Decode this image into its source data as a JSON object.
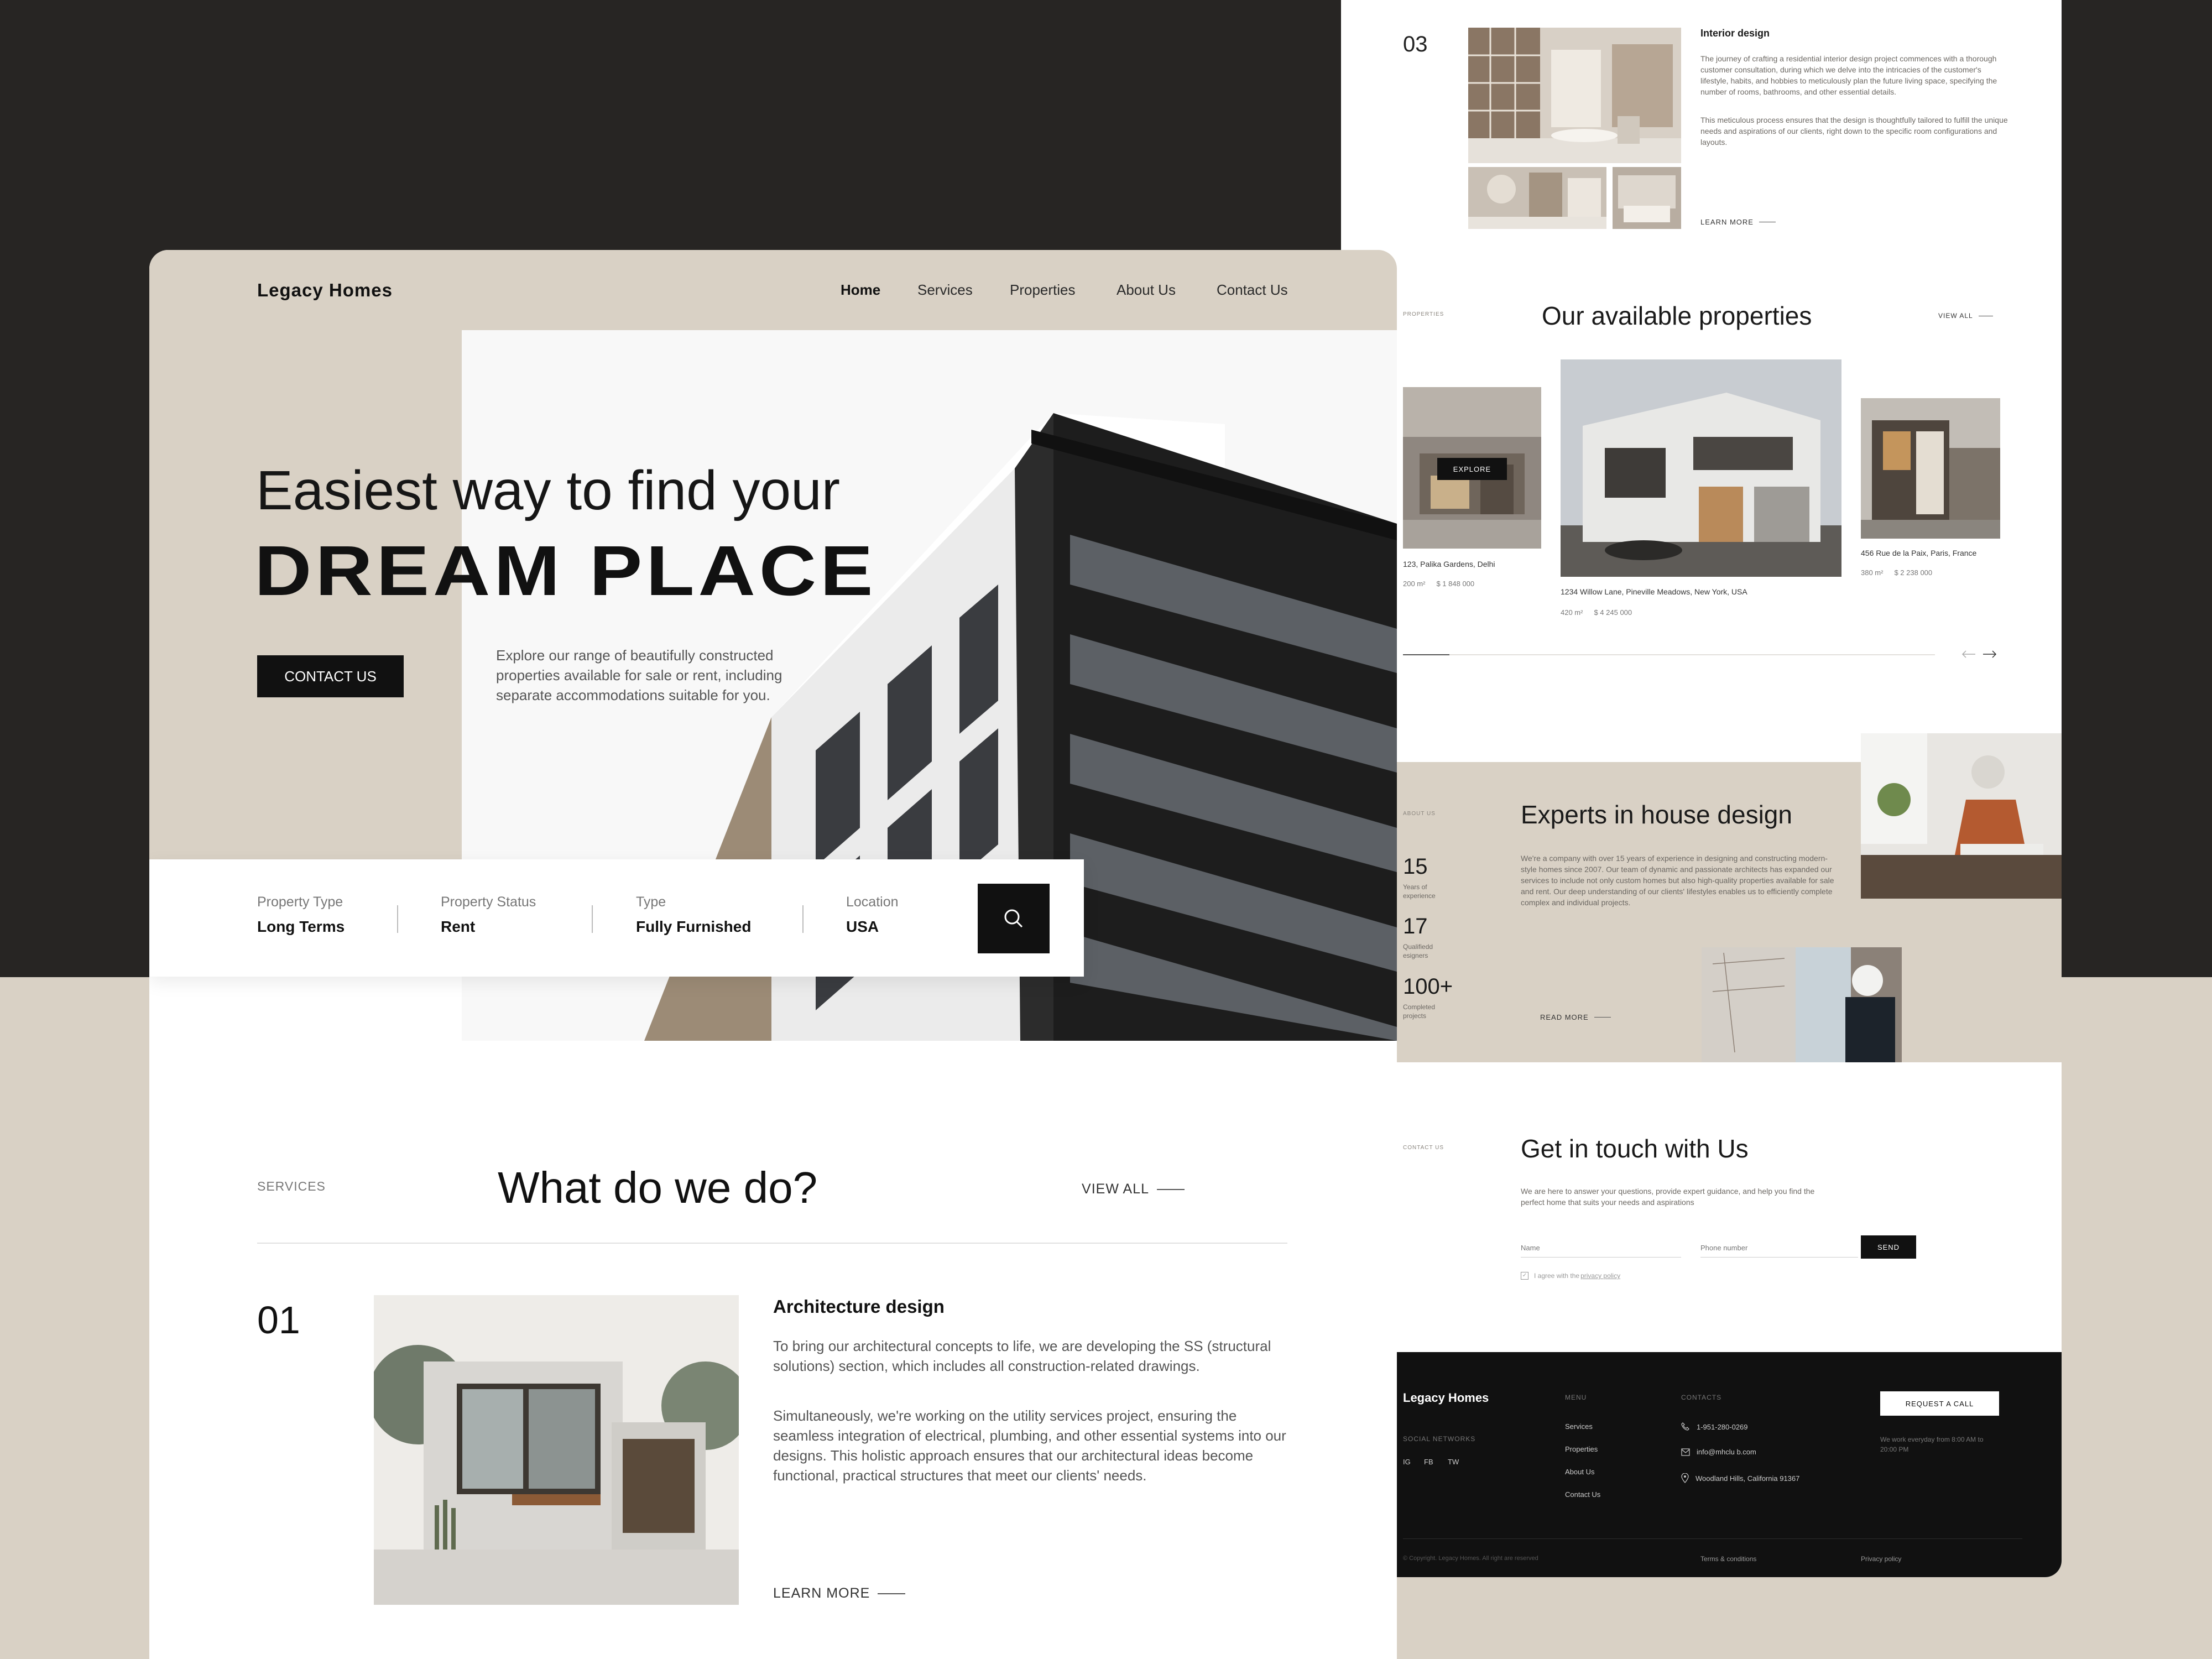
{
  "brand": "Legacy Homes",
  "nav": {
    "items": [
      "Home",
      "Services",
      "Properties",
      "About Us",
      "Contact Us"
    ],
    "active": "Home"
  },
  "hero": {
    "line1": "Easiest way to find your",
    "line2": "DREAM PLACE",
    "cta": "CONTACT US",
    "description": "Explore our range of beautifully constructed properties available for sale or rent, including separate accommodations suitable for you."
  },
  "search": {
    "fields": [
      {
        "label": "Property Type",
        "value": "Long Terms"
      },
      {
        "label": "Property Status",
        "value": "Rent"
      },
      {
        "label": "Type",
        "value": "Fully Furnished"
      },
      {
        "label": "Location",
        "value": "USA"
      }
    ],
    "button_icon": "search-icon"
  },
  "services": {
    "tag": "SERVICES",
    "title": "What do we do?",
    "view_all": "VIEW ALL",
    "items": [
      {
        "num": "01",
        "title": "Architecture design",
        "p1": "To bring our architectural concepts to life, we are developing the SS (structural solutions) section, which includes all construction-related drawings.",
        "p2": "Simultaneously, we're working on the utility services project, ensuring the seamless integration of electrical, plumbing, and other essential systems into our designs. This holistic approach ensures that our architectural ideas become functional, practical structures that meet our clients' needs.",
        "link": "LEARN MORE"
      },
      {
        "num": "03",
        "title": "Interior design",
        "p1": "The journey of crafting a residential interior design project commences with a thorough customer consultation, during which we delve into the intricacies of the customer's lifestyle, habits, and hobbies to meticulously plan the future living space, specifying the number of rooms, bathrooms, and other essential details.",
        "p2": "This meticulous process ensures that the design is thoughtfully tailored to fulfill the unique needs and aspirations of our clients, right down to the specific room configurations and layouts.",
        "link": "LEARN MORE"
      }
    ]
  },
  "properties": {
    "tag": "PROPERTIES",
    "title": "Our available properties",
    "view_all": "VIEW ALL",
    "explore": "EXPLORE",
    "items": [
      {
        "address": "123, Palika Gardens, Delhi",
        "area": "200 m²",
        "price": "$ 1 848 000"
      },
      {
        "address": "1234 Willow Lane, Pineville Meadows, New York, USA",
        "area": "420 m²",
        "price": "$ 4 245 000"
      },
      {
        "address": "456 Rue de la Paix, Paris, France",
        "area": "380 m²",
        "price": "$ 2 238 000"
      }
    ]
  },
  "about": {
    "tag": "ABOUT US",
    "title": "Experts in house design",
    "text": "We're a company with over 15 years of experience in designing and constructing modern-style homes since 2007. Our team of dynamic and passionate architects has expanded our services to include not only custom homes but also high-quality properties available for sale and rent. Our deep understanding of our clients' lifestyles enables us to efficiently complete complex and individual projects.",
    "stats": [
      {
        "num": "15",
        "label": "Years of experience"
      },
      {
        "num": "17",
        "label": "Qualifiedd esigners"
      },
      {
        "num": "100+",
        "label": "Completed projects"
      }
    ],
    "link": "READ MORE"
  },
  "contact": {
    "tag": "CONTACT US",
    "title": "Get in touch with Us",
    "text": "We are here to answer your questions, provide expert guidance, and help you find the perfect home that suits your needs and aspirations",
    "name_placeholder": "Name",
    "phone_placeholder": "Phone number",
    "send": "SEND",
    "agree": "I agree with the ",
    "policy": "privacy policy"
  },
  "footer": {
    "brand": "Legacy Homes",
    "social_title": "SOCIAL NETWORKS",
    "social": [
      "IG",
      "FB",
      "TW"
    ],
    "menu_title": "MENU",
    "menu": [
      "Services",
      "Properties",
      "About Us",
      "Contact Us"
    ],
    "contacts_title": "CONTACTS",
    "phone": "1-951-280-0269",
    "email": "info@mhclu b.com",
    "address": "Woodland Hills, California 91367",
    "request": "REQUEST A CALL",
    "hours": "We work everyday from 8:00 AM to 20:00 PM",
    "copyright": "© Copyright. Legacy Homes. All right are reserved",
    "terms": "Terms & conditions",
    "privacy": "Privacy policy"
  },
  "colors": {
    "beige": "#d9d1c5",
    "dark": "#272523",
    "black": "#111111"
  }
}
